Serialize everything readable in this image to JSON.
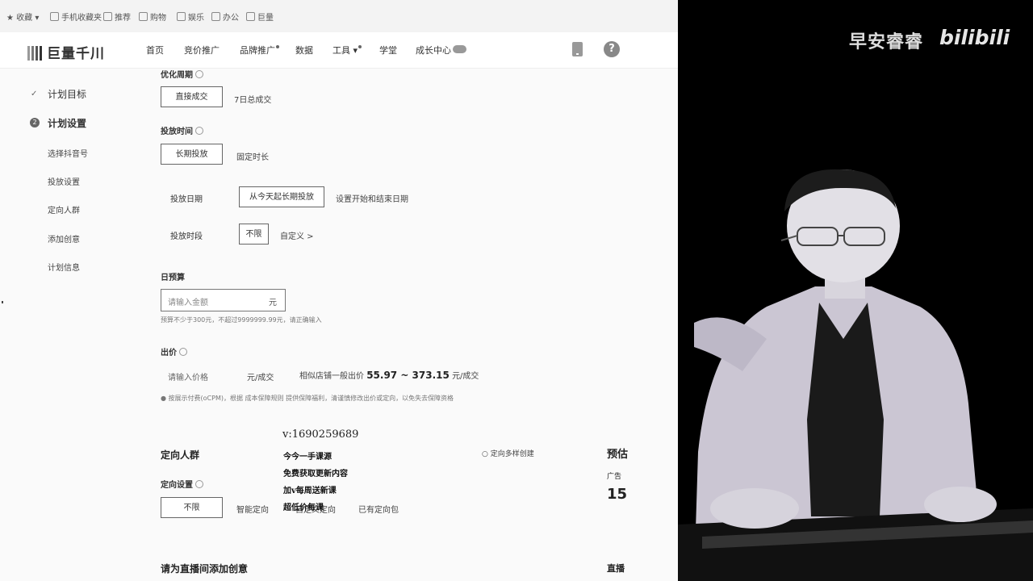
{
  "bookmarks": [
    {
      "label": "收藏",
      "icon": "star-icon"
    },
    {
      "label": "手机收藏夹",
      "icon": "phone-small-icon"
    },
    {
      "label": "推荐",
      "icon": "grid-icon"
    },
    {
      "label": "购物",
      "icon": "grid-icon"
    },
    {
      "label": "娱乐",
      "icon": "grid-icon"
    },
    {
      "label": "办公",
      "icon": "grid-icon"
    },
    {
      "label": "巨量",
      "icon": "page-icon"
    }
  ],
  "header": {
    "logo": "巨量千川",
    "nav": [
      "首页",
      "竞价推广",
      "品牌推广",
      "数据",
      "工具",
      "学堂",
      "成长中心"
    ]
  },
  "sidebar": {
    "sections": [
      {
        "label": "计划目标",
        "state": "done"
      },
      {
        "label": "计划设置",
        "state": "current",
        "num": "2"
      }
    ],
    "subitems": [
      "选择抖音号",
      "投放设置",
      "定向人群",
      "添加创意",
      "计划信息"
    ]
  },
  "form": {
    "opt_goal_label": "优化周期",
    "opt_goal_options": [
      "直接成交",
      "7日总成交"
    ],
    "time_label": "投放时间",
    "time_options": [
      "长期投放",
      "固定时长"
    ],
    "date_label": "投放日期",
    "date_selected": "从今天起长期投放",
    "date_alt": "设置开始和结束日期",
    "period_label": "投放时段",
    "period_selected": "不限",
    "period_alt": "自定义 >",
    "budget_label": "日预算",
    "budget_placeholder": "请输入金额",
    "budget_unit": "元",
    "budget_hint": "预算不少于300元，不超过9999999.99元，请正确输入",
    "bid_label": "出价",
    "bid_placeholder": "请输入价格",
    "bid_unit": "元/成交",
    "bid_range_prefix": "相似店铺一般出价",
    "bid_range": "55.97 ~ 373.15",
    "bid_range_unit": "元/成交",
    "bid_note": "按展示付费(oCPM)，根据 成本保障规则 提供保障福利，清谨慎修改出价或定向，以免失去保障资格"
  },
  "targeting": {
    "title": "定向人群",
    "multi": "定向多样创建",
    "setting_label": "定向设置",
    "options": [
      "不限",
      "智能定向",
      "自定义定向",
      "已有定向包"
    ]
  },
  "creative_title": "请为直播间添加创意",
  "right_partial": {
    "title": "预估",
    "sub": "广告",
    "num": "15",
    "bottom": "直播"
  },
  "overlay": {
    "wechat": "v:1690259689",
    "lines": [
      "今今一手课源",
      "免费获取更新内容",
      "加v每周送新课",
      "超低价每课"
    ]
  },
  "video": {
    "brand": "早安睿睿",
    "site": "bilibili"
  }
}
